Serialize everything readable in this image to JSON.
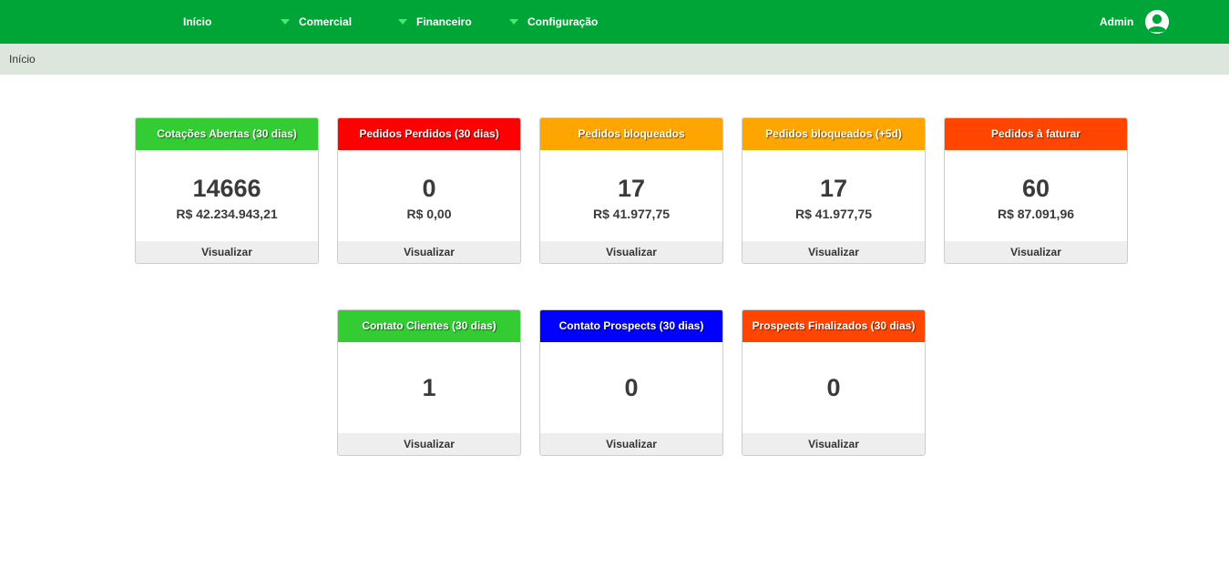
{
  "nav": {
    "home": "Início",
    "commercial": "Comercial",
    "financial": "Financeiro",
    "settings": "Configuração",
    "user": "Admin",
    "dropdown_icon_color": "#3fef6b"
  },
  "breadcrumb": "Início",
  "colors": {
    "topbar": "#00a538",
    "breadcrumb_bg": "#dde6dd",
    "green": "#33cc33",
    "red": "#ff0000",
    "orange": "#ffa500",
    "orange_red": "#ff4500",
    "blue": "#0000ff"
  },
  "cards": [
    {
      "title": "Cotações Abertas (30 dias)",
      "value": "14666",
      "money": "R$ 42.234.943,21",
      "link": "Visualizar",
      "color": "#33cc33"
    },
    {
      "title": "Pedidos Perdidos (30 dias)",
      "value": "0",
      "money": "R$ 0,00",
      "link": "Visualizar",
      "color": "#ff0000"
    },
    {
      "title": "Pedidos bloqueados",
      "value": "17",
      "money": "R$ 41.977,75",
      "link": "Visualizar",
      "color": "#ffa500"
    },
    {
      "title": "Pedidos bloqueados (+5d)",
      "value": "17",
      "money": "R$ 41.977,75",
      "link": "Visualizar",
      "color": "#ffa500"
    },
    {
      "title": "Pedidos à faturar",
      "value": "60",
      "money": "R$ 87.091,96",
      "link": "Visualizar",
      "color": "#ff4500"
    },
    {
      "title": "Contato Clientes (30 dias)",
      "value": "1",
      "link": "Visualizar",
      "color": "#33cc33"
    },
    {
      "title": "Contato Prospects (30 dias)",
      "value": "0",
      "link": "Visualizar",
      "color": "#0000ff"
    },
    {
      "title": "Prospects Finalizados (30 dias)",
      "value": "0",
      "link": "Visualizar",
      "color": "#ff4500"
    }
  ]
}
